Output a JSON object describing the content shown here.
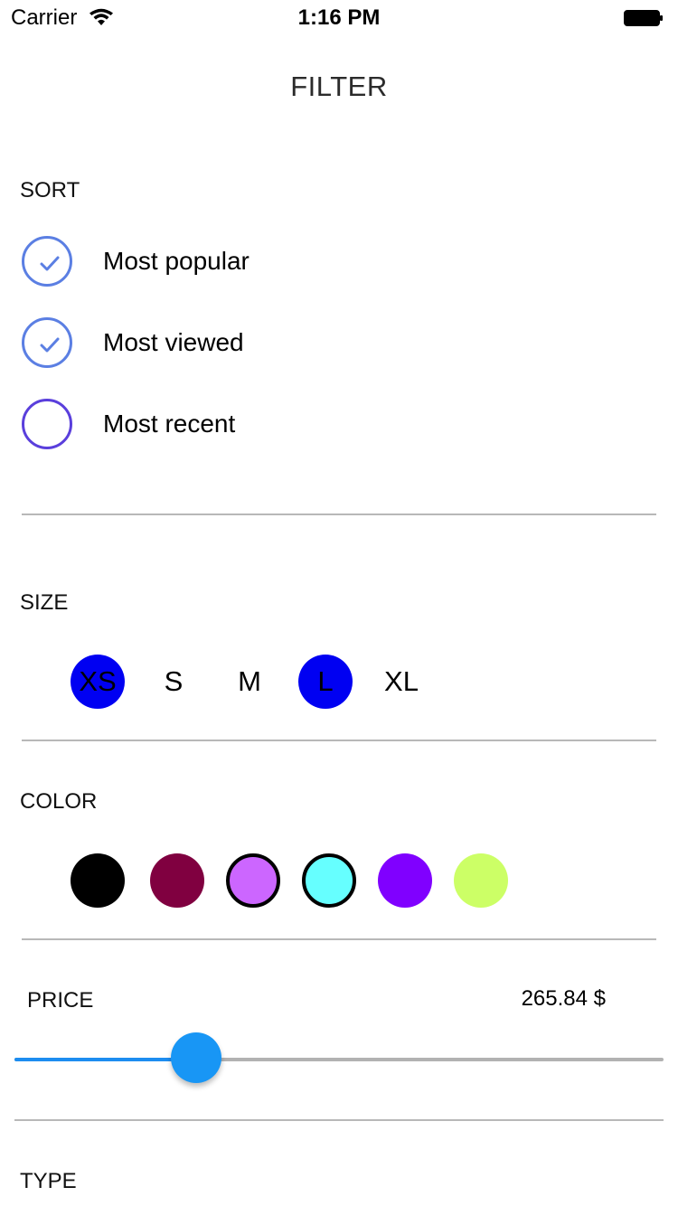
{
  "status_bar": {
    "carrier": "Carrier",
    "time": "1:16 PM",
    "wifi_icon": "wifi-icon",
    "battery_icon": "battery-icon"
  },
  "title": "FILTER",
  "sort": {
    "label": "SORT",
    "options": [
      {
        "label": "Most popular",
        "checked": true
      },
      {
        "label": "Most viewed",
        "checked": true
      },
      {
        "label": "Most recent",
        "checked": false
      }
    ],
    "check_icon": "checkmark-icon"
  },
  "size": {
    "label": "SIZE",
    "options": [
      {
        "label": "XS",
        "selected": true
      },
      {
        "label": "S",
        "selected": false
      },
      {
        "label": "M",
        "selected": false
      },
      {
        "label": "L",
        "selected": true
      },
      {
        "label": "XL",
        "selected": false
      }
    ],
    "selected_color": "#0000f2"
  },
  "color": {
    "label": "COLOR",
    "swatches": [
      {
        "color": "#000000",
        "selected": false
      },
      {
        "color": "#800040",
        "selected": false
      },
      {
        "color": "#cc66ff",
        "selected": true
      },
      {
        "color": "#66ffff",
        "selected": true
      },
      {
        "color": "#8000ff",
        "selected": false
      },
      {
        "color": "#ccff66",
        "selected": false
      }
    ]
  },
  "price": {
    "label": "PRICE",
    "value": "265.84 $",
    "slider_fraction": 0.28,
    "accent": "#1896f5"
  },
  "type": {
    "label": "TYPE"
  }
}
